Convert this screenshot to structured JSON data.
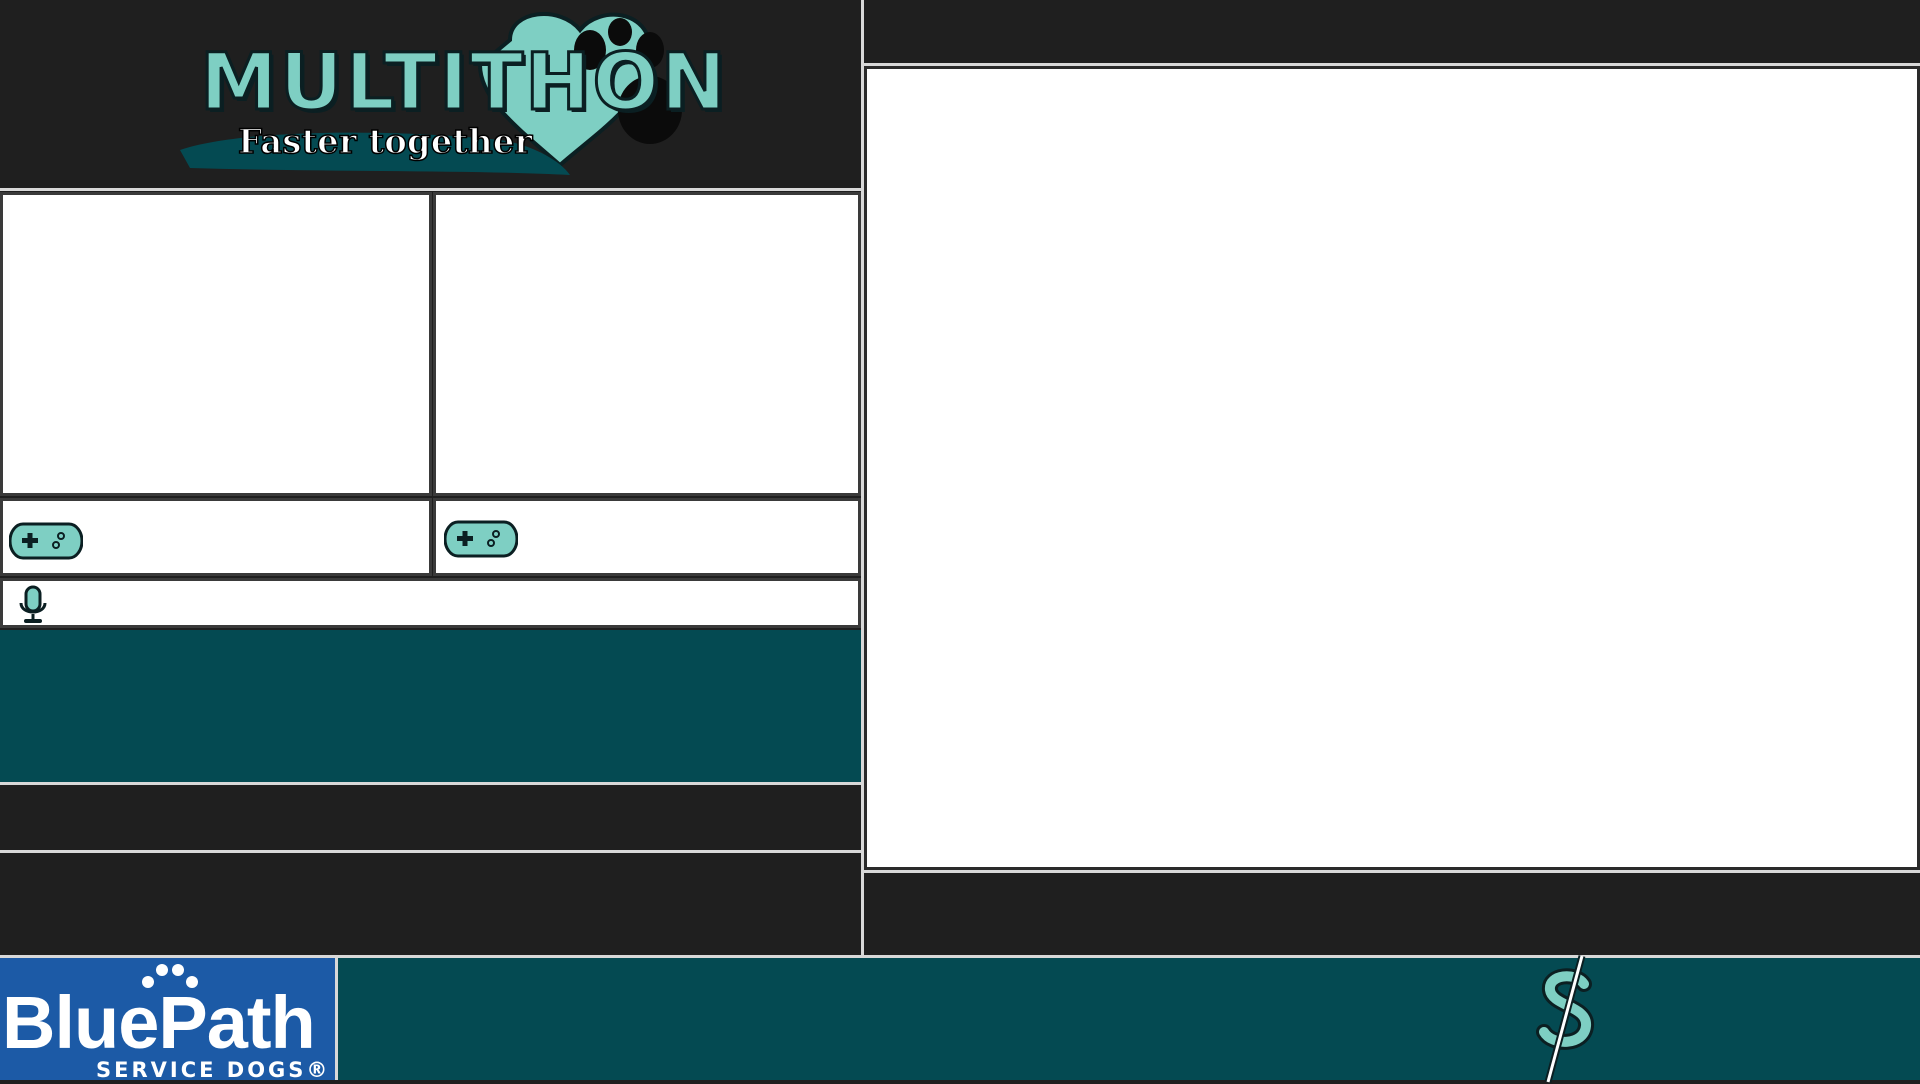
{
  "logo": {
    "title": "MULTITHON",
    "subtitle": "Faster together"
  },
  "sponsor": {
    "name": "BluePath",
    "tagline": "SERVICE DOGS®"
  },
  "icons": {
    "runner_1": "gamepad-icon",
    "runner_2": "gamepad-icon",
    "commentary": "microphone-icon",
    "donation": "dollar-sign-icon"
  },
  "colors": {
    "background": "#1f1f1f",
    "teal_panel": "#044a52",
    "accent": "#7ecfc3",
    "sponsor_blue": "#1c5aa6",
    "slot": "#ffffff"
  }
}
